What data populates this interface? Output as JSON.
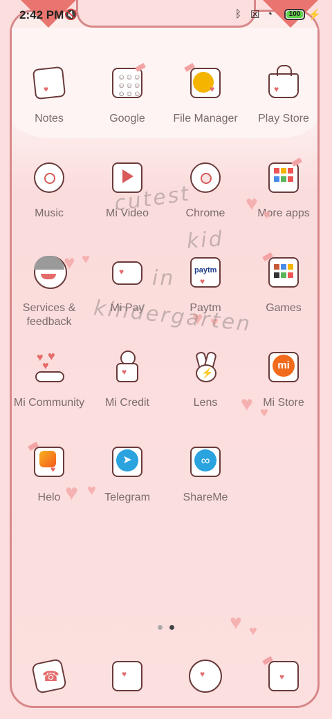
{
  "status_bar": {
    "time": "2:42 PM",
    "icons": [
      "mute-icon",
      "bluetooth-icon",
      "no-sim-icon",
      "wifi-icon",
      "charging-icon"
    ],
    "battery_percent": "100",
    "battery_level": 1.0
  },
  "apps": [
    {
      "label": "Notes",
      "icon": "notes-icon"
    },
    {
      "label": "Google",
      "icon": "google-folder-icon"
    },
    {
      "label": "File Manager",
      "icon": "file-manager-icon"
    },
    {
      "label": "Play Store",
      "icon": "play-store-icon"
    },
    {
      "label": "Music",
      "icon": "music-icon"
    },
    {
      "label": "Mi Video",
      "icon": "mi-video-icon"
    },
    {
      "label": "Chrome",
      "icon": "chrome-icon"
    },
    {
      "label": "More apps",
      "icon": "more-apps-folder-icon"
    },
    {
      "label": "Services & feedback",
      "icon": "services-feedback-icon"
    },
    {
      "label": "Mi Pay",
      "icon": "mi-pay-icon"
    },
    {
      "label": "Paytm",
      "icon": "paytm-icon"
    },
    {
      "label": "Games",
      "icon": "games-folder-icon"
    },
    {
      "label": "Mi Community",
      "icon": "mi-community-icon"
    },
    {
      "label": "Mi Credit",
      "icon": "mi-credit-icon"
    },
    {
      "label": "Lens",
      "icon": "lens-icon"
    },
    {
      "label": "Mi Store",
      "icon": "mi-store-icon"
    },
    {
      "label": "Helo",
      "icon": "helo-icon"
    },
    {
      "label": "Telegram",
      "icon": "telegram-icon"
    },
    {
      "label": "ShareMe",
      "icon": "shareme-icon"
    }
  ],
  "watermark": {
    "line1": "cutest",
    "line2": "kid",
    "line3": "in",
    "line4": "kindergarten"
  },
  "page_indicator": {
    "pages": 2,
    "current": 2
  },
  "dock": [
    {
      "icon": "phone-icon"
    },
    {
      "icon": "messages-icon"
    },
    {
      "icon": "browser-icon"
    },
    {
      "icon": "camera-icon"
    }
  ],
  "colors": {
    "background": "#fbdedd",
    "frame": "#d8888a",
    "label": "#7b6c6c",
    "accent": "#e56b6b",
    "paytm_blue": "#1b3a8a",
    "mi_orange": "#f26b1d",
    "telegram_blue": "#2aa3df",
    "file_yellow": "#f4b400"
  }
}
